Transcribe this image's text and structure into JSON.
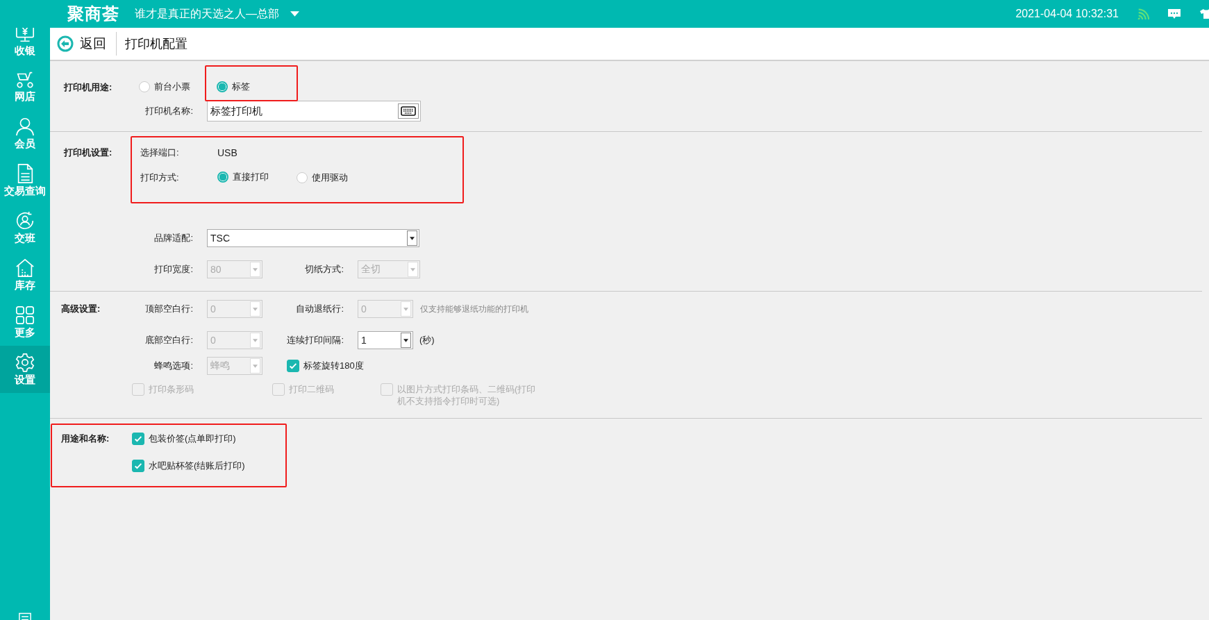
{
  "top_bar": {
    "logo": "聚商荟",
    "store": "谁才是真正的天选之人—总部",
    "datetime": "2021-04-04 10:32:31"
  },
  "sidebar": {
    "items": [
      {
        "label": "收银",
        "selected": false
      },
      {
        "label": "网店",
        "selected": false
      },
      {
        "label": "会员",
        "selected": false
      },
      {
        "label": "交易查询",
        "selected": false
      },
      {
        "label": "交班",
        "selected": false
      },
      {
        "label": "库存",
        "selected": false
      },
      {
        "label": "更多",
        "selected": false
      },
      {
        "label": "设置",
        "selected": true
      }
    ]
  },
  "header": {
    "back": "返回",
    "title": "打印机配置"
  },
  "usage": {
    "label": "打印机用途:",
    "options": [
      {
        "label": "前台小票",
        "selected": false
      },
      {
        "label": "标签",
        "selected": true
      }
    ],
    "name_label": "打印机名称:",
    "name_value": "标签打印机"
  },
  "settings": {
    "label": "打印机设置:",
    "port_label": "选择端口:",
    "port_value": "USB",
    "mode_label": "打印方式:",
    "modes": [
      {
        "label": "直接打印",
        "selected": true
      },
      {
        "label": "使用驱动",
        "selected": false
      }
    ],
    "brand": {
      "label": "品牌适配:",
      "value": "TSC",
      "disabled": false
    },
    "width": {
      "label": "打印宽度:",
      "value": "80",
      "disabled": true
    },
    "cut": {
      "label": "切纸方式:",
      "value": "全切",
      "disabled": true
    }
  },
  "advanced": {
    "label": "高级设置:",
    "top_blank": {
      "label": "顶部空白行:",
      "value": "0",
      "disabled": true
    },
    "auto_feed": {
      "label": "自动退纸行:",
      "value": "0",
      "disabled": true
    },
    "auto_feed_note": "仅支持能够退纸功能的打印机",
    "bottom_blank": {
      "label": "底部空白行:",
      "value": "0",
      "disabled": true
    },
    "interval": {
      "label": "连续打印间隔:",
      "value": "1",
      "disabled": false
    },
    "interval_unit": "(秒)",
    "beep": {
      "label": "蜂鸣选项:",
      "value": "蜂鸣",
      "disabled": true
    },
    "checks": [
      {
        "label": "标签旋转180度",
        "checked": true
      },
      {
        "label": "打印条形码",
        "checked": false,
        "disabled": true
      },
      {
        "label": "打印二维码",
        "checked": false,
        "disabled": true
      },
      {
        "label": "以图片方式打印条码、二维码(打印机不支持指令打印时可选)",
        "checked": false,
        "disabled": true
      }
    ]
  },
  "purposes": {
    "label": "用途和名称:",
    "items": [
      {
        "label": "包装价签(点单即打印)",
        "checked": true
      },
      {
        "label": "水吧贴杯签(结账后打印)",
        "checked": true
      }
    ]
  }
}
